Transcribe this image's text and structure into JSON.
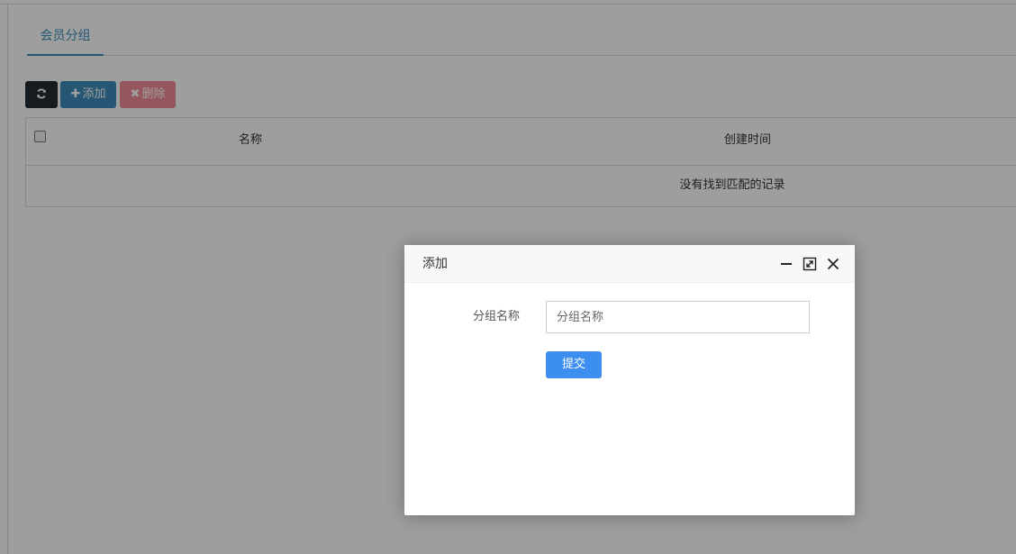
{
  "tabs": [
    {
      "label": "会员分组"
    }
  ],
  "toolbar": {
    "refresh_icon": "refresh-icon",
    "add_label": "添加",
    "add_icon": "plus-icon",
    "delete_label": "删除",
    "delete_icon": "times-icon"
  },
  "table": {
    "columns": [
      "名称",
      "创建时间"
    ],
    "rows": [],
    "empty_text": "没有找到匹配的记录"
  },
  "modal": {
    "title": "添加",
    "controls": [
      "minimize-icon",
      "maximize-icon",
      "close-icon"
    ],
    "field_label": "分组名称",
    "field_placeholder": "分组名称",
    "field_value": "",
    "submit_label": "提交"
  },
  "colors": {
    "primary": "#3c8dbc",
    "dark": "#222d32",
    "danger_disabled": "#f28b97",
    "submit": "#3d8fef"
  }
}
